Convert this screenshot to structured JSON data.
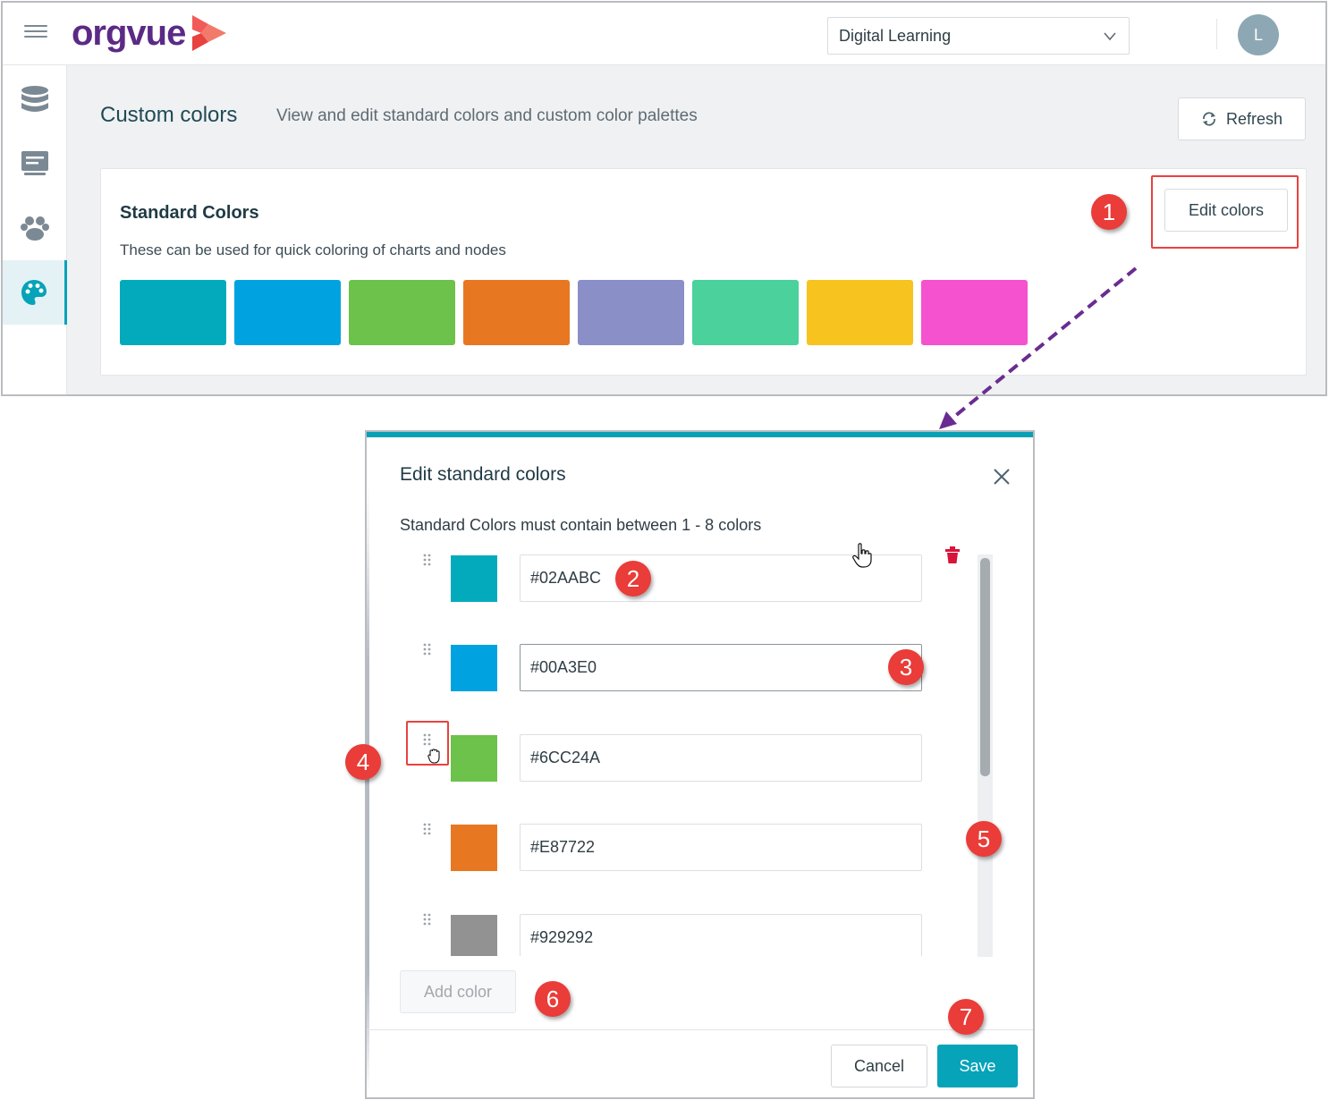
{
  "app": {
    "logo_text": "orgvue",
    "workspace": "Digital Learning",
    "user_initial": "L"
  },
  "sidebar": {
    "items": [
      {
        "icon": "database-icon"
      },
      {
        "icon": "document-icon"
      },
      {
        "icon": "people-icon"
      },
      {
        "icon": "palette-icon",
        "active": true
      }
    ]
  },
  "page": {
    "title": "Custom colors",
    "subtitle": "View and edit standard colors and custom color palettes",
    "refresh_label": "Refresh"
  },
  "standard_colors": {
    "title": "Standard Colors",
    "description": "These can be used for quick coloring of charts and nodes",
    "edit_label": "Edit colors",
    "swatches": [
      "#02AABC",
      "#00A3E0",
      "#6CC24A",
      "#E87722",
      "#8A8FC8",
      "#4AD19C",
      "#F7C31E",
      "#F552CF"
    ]
  },
  "dialog": {
    "title": "Edit standard colors",
    "description": "Standard Colors must contain between 1 - 8 colors",
    "colors": [
      {
        "hex": "#02AABC",
        "swatch": "#02AABC"
      },
      {
        "hex": "#00A3E0",
        "swatch": "#00A3E0"
      },
      {
        "hex": "#6CC24A",
        "swatch": "#6CC24A"
      },
      {
        "hex": "#E87722",
        "swatch": "#E87722"
      },
      {
        "hex": "#929292",
        "swatch": "#929292"
      }
    ],
    "add_color_label": "Add color",
    "cancel_label": "Cancel",
    "save_label": "Save"
  },
  "annotations": [
    "1",
    "2",
    "3",
    "4",
    "5",
    "6",
    "7"
  ],
  "theme": {
    "accent": "#06A3B9",
    "brand": "#5B2A86",
    "marker": "#EA3C38",
    "arrow": "#6A2C91"
  }
}
